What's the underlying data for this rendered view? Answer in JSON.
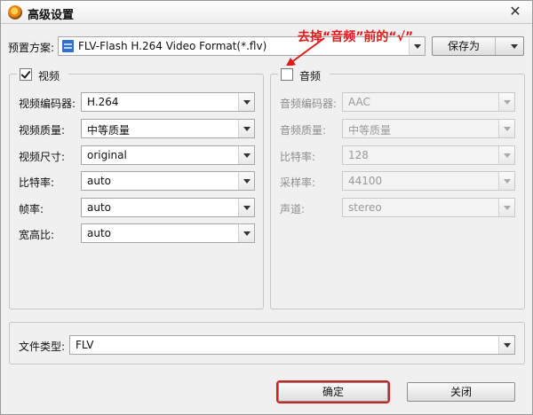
{
  "window": {
    "title": "高级设置",
    "close_glyph": "✕"
  },
  "preset": {
    "label": "预置方案:",
    "value": "FLV-Flash H.264 Video Format(*.flv)",
    "save_as": "保存为"
  },
  "annotation": {
    "text": "去掉“音频”前的“√”",
    "color": "#e11b1b"
  },
  "video": {
    "title": "视频",
    "checked": true,
    "fields": [
      {
        "label": "视频编码器:",
        "value": "H.264"
      },
      {
        "label": "视频质量:",
        "value": "中等质量"
      },
      {
        "label": "视频尺寸:",
        "value": "original"
      },
      {
        "label": "比特率:",
        "value": "auto"
      },
      {
        "label": "帧率:",
        "value": "auto"
      },
      {
        "label": "宽高比:",
        "value": "auto"
      }
    ]
  },
  "audio": {
    "title": "音频",
    "checked": false,
    "fields": [
      {
        "label": "音频编码器:",
        "value": "AAC"
      },
      {
        "label": "音频质量:",
        "value": "中等质量"
      },
      {
        "label": "比特率:",
        "value": "128"
      },
      {
        "label": "采样率:",
        "value": "44100"
      },
      {
        "label": "声道:",
        "value": "stereo"
      }
    ]
  },
  "file_type": {
    "label": "文件类型:",
    "value": "FLV"
  },
  "buttons": {
    "ok": "确定",
    "close": "关闭"
  },
  "colors": {
    "highlight": "#d12020",
    "annotation": "#e11b1b"
  },
  "icons": {
    "app": "app-logo-icon",
    "preset": "film-icon",
    "close": "close-icon"
  }
}
